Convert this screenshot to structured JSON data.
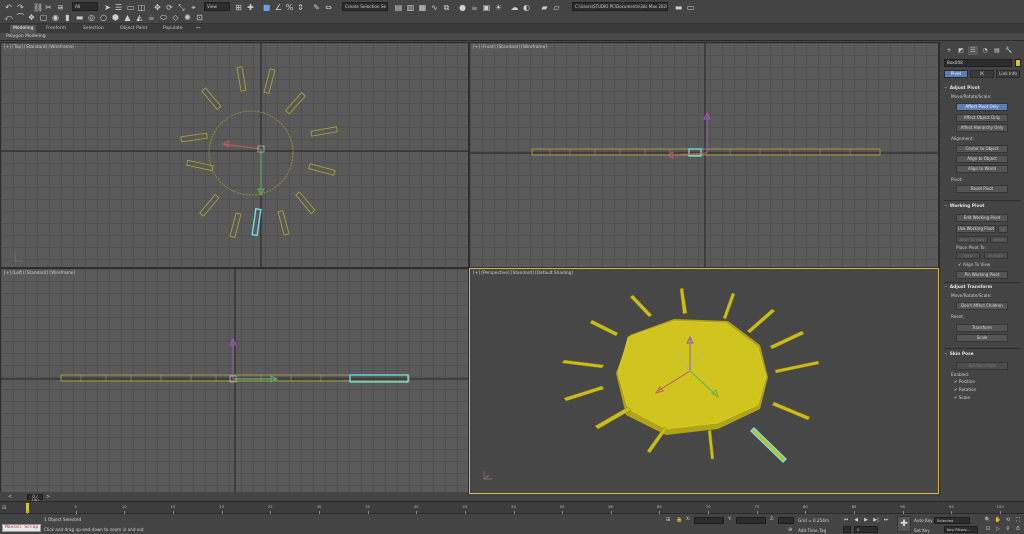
{
  "toolbar": {
    "selection_filter": "All",
    "view_dropdown": "View",
    "named_selection_placeholder": "Create Selection Se",
    "project_path": "C:\\Users\\STUDIO PC\\Documents\\3ds Max 2020"
  },
  "ribbon": {
    "tabs": [
      "Modeling",
      "Freeform",
      "Selection",
      "Object Paint",
      "Populate"
    ],
    "active_tab": "Modeling",
    "subpanel_label": "Polygon Modeling"
  },
  "viewports": {
    "top": "[+] [Top] [Standard] [Wireframe]",
    "front": "[+] [Front] [Standard] [Wireframe]",
    "left": "[+] [Left] [Standard] [Wireframe]",
    "perspective": "[+] [Perspective] [Standard] [Default Shading]"
  },
  "command_panel": {
    "object_name": "Box008",
    "color_hex": "#d9c619",
    "subtabs": [
      "Pivot",
      "IK",
      "Link Info"
    ],
    "adjust_pivot": {
      "title": "Adjust Pivot",
      "move_group": "Move/Rotate/Scale:",
      "affect_pivot_only": "Affect Pivot Only",
      "affect_object_only": "Affect Object Only",
      "affect_hierarchy_only": "Affect Hierarchy Only",
      "alignment_label": "Alignment:",
      "center_to_object": "Center to Object",
      "align_to_object": "Align to Object",
      "align_to_world": "Align to World",
      "pivot_label": "Pivot:",
      "reset_pivot": "Reset Pivot"
    },
    "working_pivot": {
      "title": "Working Pivot",
      "edit_working_pivot": "Edit Working Pivot",
      "use_working_pivot": "Use Working Pivot",
      "use_working_pivot_extra": "...",
      "align_to_view": "Align To View",
      "reset": "Reset",
      "place_pivot_to": "Place Pivot To:",
      "view": "View",
      "surface": "Surface",
      "align_to_view_check": "Align To View",
      "pin_working_pivot": "Pin Working Pivot"
    },
    "adjust_transform": {
      "title": "Adjust Transform",
      "move_group": "Move/Rotate/Scale:",
      "dont_affect_children": "Don't Affect Children",
      "reset_label": "Reset:",
      "transform": "Transform",
      "scale": "Scale"
    },
    "skin_pose": {
      "title": "Skin Pose",
      "set_skin_pose": "Set Skin Pose",
      "enabled_label": "Enabled:",
      "position": "Position",
      "rotation": "Rotation",
      "scale": "Scale"
    }
  },
  "timeline": {
    "frame_display": "0 / 100",
    "ticks": [
      "0",
      "5",
      "10",
      "15",
      "20",
      "25",
      "30",
      "35",
      "40",
      "45",
      "50",
      "55",
      "60",
      "65",
      "70",
      "75",
      "80",
      "85",
      "90",
      "95",
      "100"
    ]
  },
  "statusbar": {
    "maxscript": "Maxsel Scrop",
    "selection_status": "1 Object Selected",
    "prompt": "Click and drag up-and-down to zoom in and out",
    "x_label": "X:",
    "y_label": "Y:",
    "z_label": "Z:",
    "grid": "Grid = 0.254m",
    "add_time_tag": "Add Time Tag",
    "auto_key": "Auto Key",
    "set_key": "Set Key",
    "selected": "Selected",
    "key_filters": "Key Filters...",
    "current_frame": "0"
  }
}
